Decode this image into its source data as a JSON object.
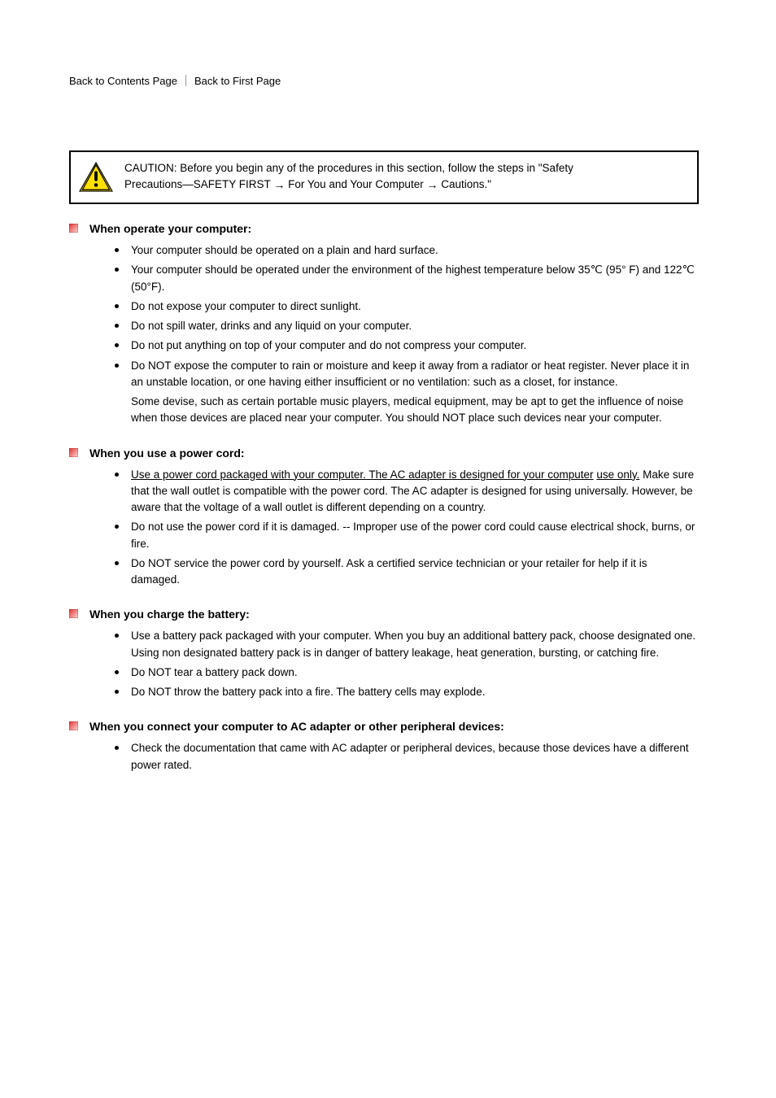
{
  "crumb_a": "Back to Contents Page",
  "crumb_b": "Back to First Page",
  "caution": {
    "line1_pre": "CAUTION: Before you begin any of the procedures in this section, follow the steps in \"Safety",
    "line2_pre": "Precautions—SAFETY FIRST ",
    "line2_mid": " For You and Your Computer ",
    "line2_post": " Cautions.\""
  },
  "sec1": {
    "title": "When operate your computer:",
    "b1": "Your computer should be operated on a plain and hard surface.",
    "b2_pre": "Your computer should be operated under the environment of the highest temperature below 35",
    "b2_mid": "(95° F) and 122",
    "b2_post": " (50°F).",
    "b3": "Do not expose your computer to direct sunlight.",
    "b4": "Do not spill water, drinks and any liquid on your computer.",
    "b5": "Do not put anything on top of your computer and do not compress your computer.",
    "b6": "Do NOT expose the computer to rain or moisture and keep it away from a radiator or heat register. Never place it in an unstable location, or one having either insufficient or no ventilation: such as a closet, for instance.",
    "b7": "Some devise, such as certain portable music players, medical equipment, may be apt to get the influence of noise when those devices are placed near your computer. You should NOT place such devices near your computer."
  },
  "sec2": {
    "title": "When you use a power cord:",
    "b1_u1": "Use a power cord packaged with your computer. The AC adapter is designed for your computer",
    "b1_u2": "use only.",
    "b1_rest": " Make sure that the wall outlet is compatible with the power cord. The AC adapter is designed for using universally. However, be aware that the voltage of a wall outlet is different depending on a country.",
    "b2": "Do not use the power cord if it is damaged. -- Improper use of the power cord could cause electrical shock, burns, or fire.",
    "b3": "Do NOT service the power cord by yourself. Ask a certified service technician or your retailer for help if it is damaged."
  },
  "sec3": {
    "title": "When you charge the battery:",
    "b1": "Use a battery pack packaged with your computer. When you buy an additional battery pack, choose designated one. Using non designated battery pack is in danger of battery leakage, heat generation, bursting, or catching fire.",
    "b2": "Do NOT tear a battery pack down.",
    "b3": "Do NOT throw the battery pack into a fire. The battery cells may explode."
  },
  "sec4": {
    "title": "When you connect your computer to AC adapter or other peripheral devices:",
    "b1": "Check the documentation that came with AC adapter or peripheral devices, because those devices have a different power rated."
  }
}
